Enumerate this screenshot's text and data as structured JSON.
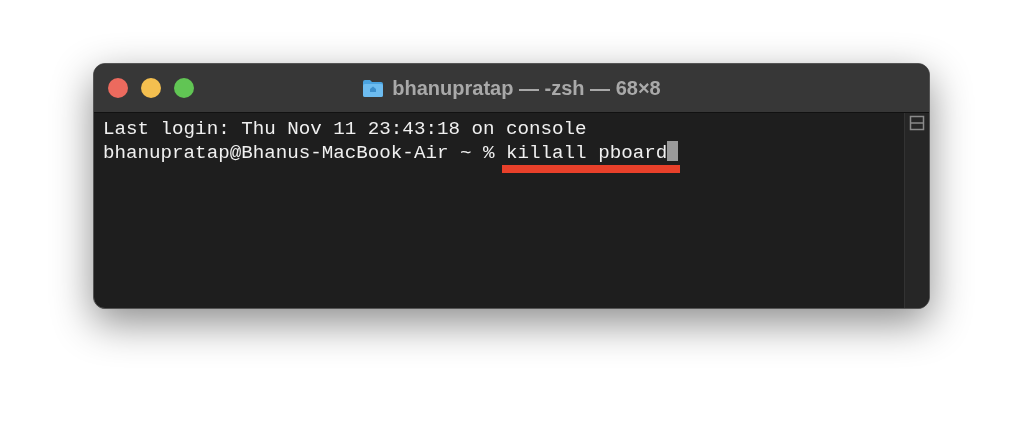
{
  "window": {
    "title": "bhanupratap — -zsh — 68×8"
  },
  "output": [
    "Last login: Thu Nov 11 23:43:18 on console"
  ],
  "prompt": {
    "text": "bhanupratap@Bhanus-MacBook-Air ~ % ",
    "command": "killall pboard",
    "cursor": true,
    "underlined": true
  }
}
